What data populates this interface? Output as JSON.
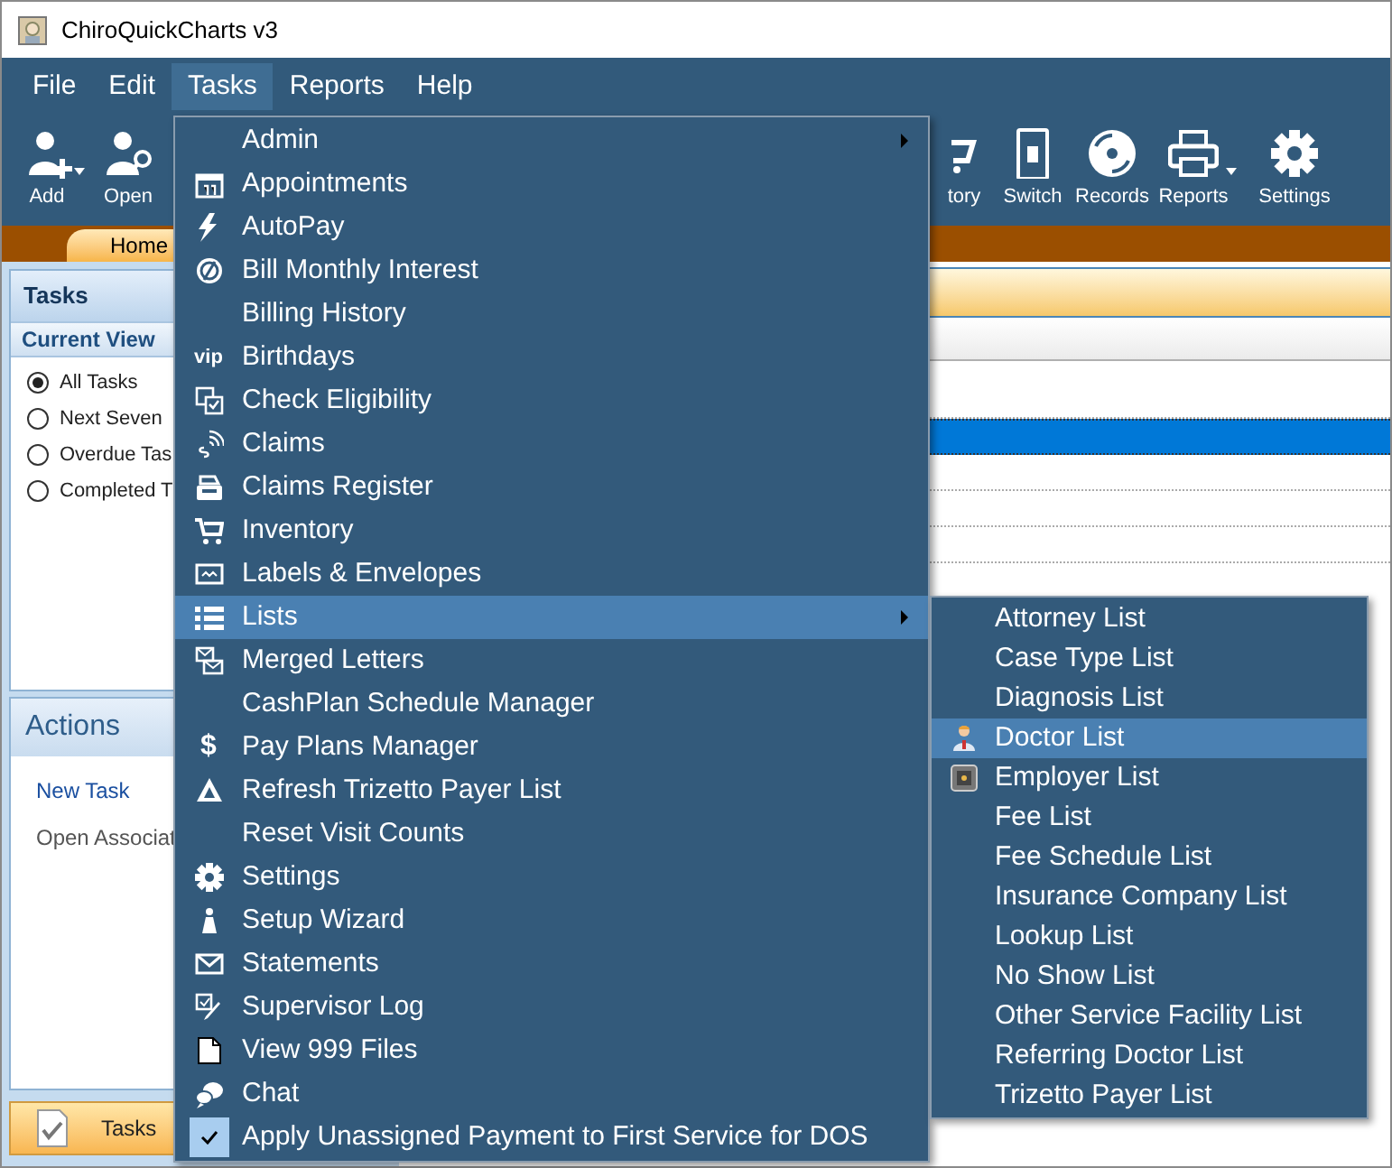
{
  "window": {
    "title": "ChiroQuickCharts v3"
  },
  "menubar": [
    {
      "label": "File",
      "selected": false
    },
    {
      "label": "Edit",
      "selected": false
    },
    {
      "label": "Tasks",
      "selected": true
    },
    {
      "label": "Reports",
      "selected": false
    },
    {
      "label": "Help",
      "selected": false
    }
  ],
  "toolbar": {
    "left": [
      {
        "label": "Add",
        "dropdown": true
      },
      {
        "label": "Open",
        "dropdown": false
      }
    ],
    "right": [
      {
        "label": "tory",
        "dropdown": false
      },
      {
        "label": "Switch",
        "dropdown": false
      },
      {
        "label": "Records",
        "dropdown": false
      },
      {
        "label": "Reports",
        "dropdown": true
      },
      {
        "label": "Settings",
        "dropdown": false
      }
    ]
  },
  "ribbon_tabs": [
    {
      "label": "Home",
      "selected": true
    }
  ],
  "sidebar": {
    "title": "Tasks",
    "section": "Current View",
    "views": [
      {
        "label": "All Tasks",
        "selected": true
      },
      {
        "label": "Next Seven",
        "selected": false
      },
      {
        "label": "Overdue Tas",
        "selected": false
      },
      {
        "label": "Completed T",
        "selected": false
      }
    ],
    "actions_title": "Actions",
    "actions": [
      {
        "label": "New Task",
        "kind": "link"
      },
      {
        "label": "Open Associat",
        "kind": "text"
      }
    ],
    "nav": [
      {
        "label": "Tasks",
        "selected": true
      }
    ]
  },
  "grid": {
    "rows": [
      {
        "selected": false
      },
      {
        "selected": true
      },
      {
        "selected": false
      },
      {
        "selected": false
      },
      {
        "selected": false
      }
    ]
  },
  "tasks_menu": [
    {
      "label": "Admin",
      "submenu": true,
      "selected": false
    },
    {
      "label": "Appointments",
      "submenu": false,
      "selected": false
    },
    {
      "label": "AutoPay",
      "submenu": false,
      "selected": false
    },
    {
      "label": "Bill Monthly Interest",
      "submenu": false,
      "selected": false
    },
    {
      "label": "Billing History",
      "submenu": false,
      "selected": false
    },
    {
      "label": "Birthdays",
      "submenu": false,
      "selected": false,
      "badge": "vip"
    },
    {
      "label": "Check Eligibility",
      "submenu": false,
      "selected": false
    },
    {
      "label": "Claims",
      "submenu": false,
      "selected": false
    },
    {
      "label": "Claims Register",
      "submenu": false,
      "selected": false
    },
    {
      "label": "Inventory",
      "submenu": false,
      "selected": false
    },
    {
      "label": "Labels & Envelopes",
      "submenu": false,
      "selected": false
    },
    {
      "label": "Lists",
      "submenu": true,
      "selected": true
    },
    {
      "label": "Merged Letters",
      "submenu": false,
      "selected": false
    },
    {
      "label": "CashPlan Schedule Manager",
      "submenu": false,
      "selected": false
    },
    {
      "label": "Pay Plans Manager",
      "submenu": false,
      "selected": false,
      "badge": "$"
    },
    {
      "label": "Refresh Trizetto Payer List",
      "submenu": false,
      "selected": false
    },
    {
      "label": "Reset Visit Counts",
      "submenu": false,
      "selected": false
    },
    {
      "label": "Settings",
      "submenu": false,
      "selected": false
    },
    {
      "label": "Setup Wizard",
      "submenu": false,
      "selected": false
    },
    {
      "label": "Statements",
      "submenu": false,
      "selected": false
    },
    {
      "label": "Supervisor Log",
      "submenu": false,
      "selected": false
    },
    {
      "label": "View 999 Files",
      "submenu": false,
      "selected": false
    },
    {
      "label": "Chat",
      "submenu": false,
      "selected": false
    },
    {
      "label": "Apply Unassigned Payment to First Service for DOS",
      "submenu": false,
      "selected": false,
      "checked": true
    }
  ],
  "lists_submenu": [
    {
      "label": "Attorney List",
      "selected": false
    },
    {
      "label": "Case Type List",
      "selected": false
    },
    {
      "label": "Diagnosis List",
      "selected": false
    },
    {
      "label": "Doctor List",
      "selected": true
    },
    {
      "label": "Employer List",
      "selected": false
    },
    {
      "label": "Fee List",
      "selected": false
    },
    {
      "label": "Fee Schedule List",
      "selected": false
    },
    {
      "label": "Insurance Company List",
      "selected": false
    },
    {
      "label": "Lookup List",
      "selected": false
    },
    {
      "label": "No Show List",
      "selected": false
    },
    {
      "label": "Other Service Facility List",
      "selected": false
    },
    {
      "label": "Referring Doctor List",
      "selected": false
    },
    {
      "label": "Trizetto Payer List",
      "selected": false
    }
  ]
}
